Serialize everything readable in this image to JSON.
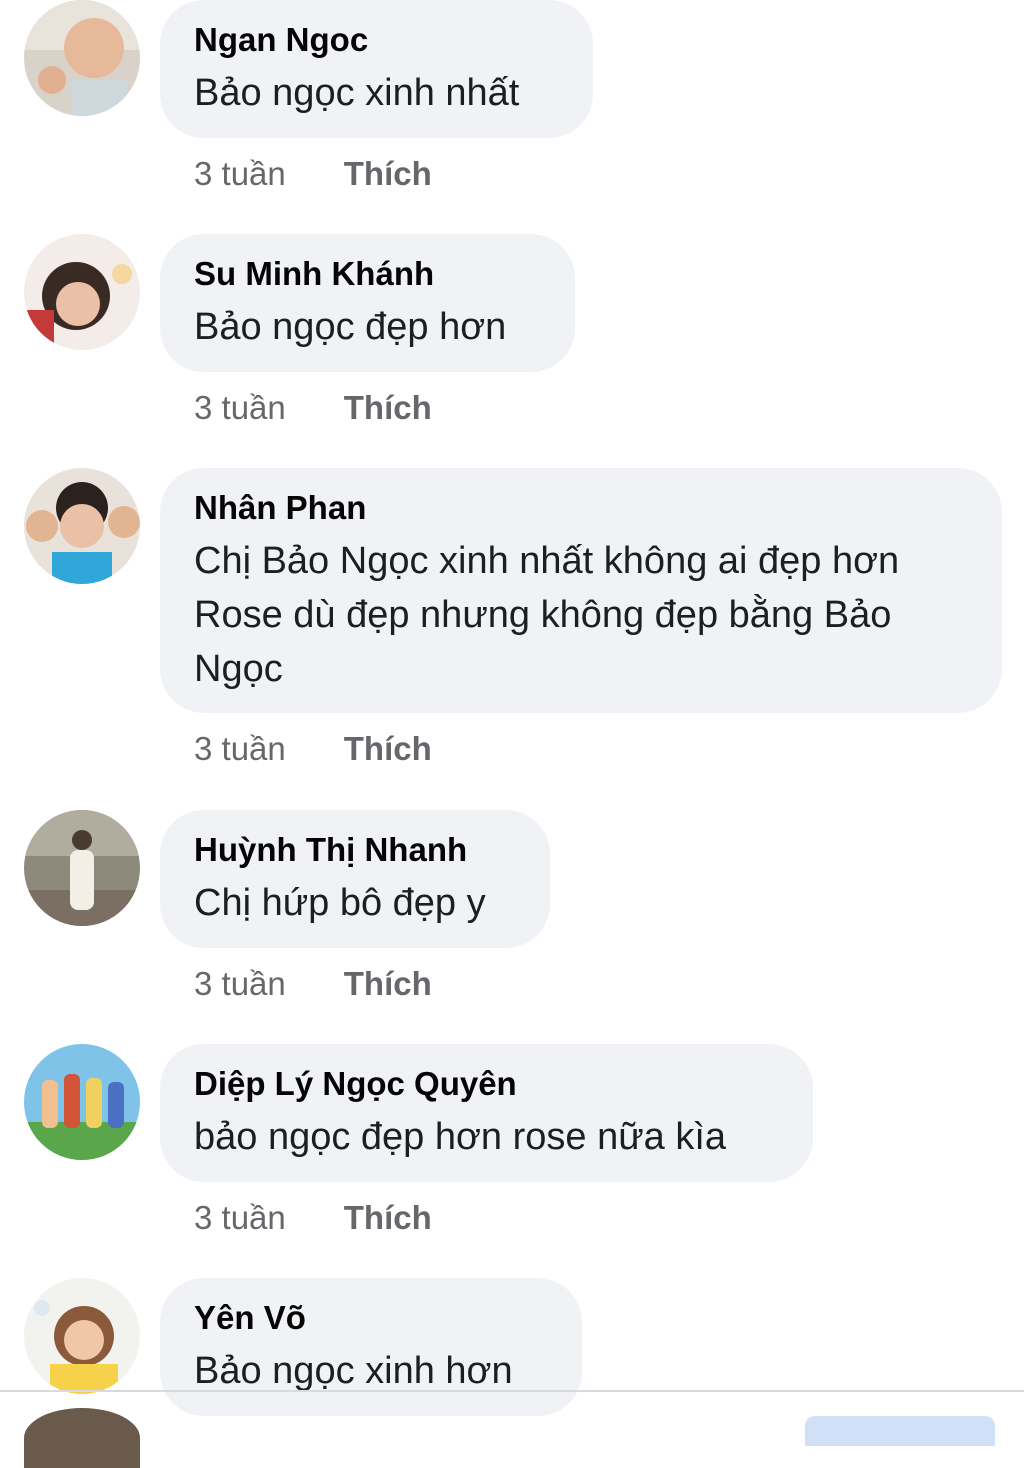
{
  "comments": [
    {
      "author": "Ngan Ngoc",
      "text": "Bảo ngọc xinh nhất",
      "time": "3 tuần",
      "like": "Thích"
    },
    {
      "author": "Su Minh Khánh",
      "text": "Bảo ngọc đẹp hơn",
      "time": "3 tuần",
      "like": "Thích"
    },
    {
      "author": "Nhân Phan",
      "text": "Chị Bảo Ngọc xinh nhất không ai đẹp hơn Rose dù đẹp nhưng không đẹp bằng Bảo Ngọc",
      "time": "3 tuần",
      "like": "Thích"
    },
    {
      "author": "Huỳnh Thị Nhanh",
      "text": "Chị hứp bô đẹp y",
      "time": "3 tuần",
      "like": "Thích"
    },
    {
      "author": "Diệp Lý Ngọc Quyên",
      "text": "bảo ngọc đẹp hơn rose nữa kìa",
      "time": "3 tuần",
      "like": "Thích"
    },
    {
      "author": "Yên Võ",
      "text": "Bảo ngọc xinh hơn"
    }
  ],
  "colors": {
    "bubble": "#f0f2f5",
    "meta_text": "#65676b",
    "author_text": "#050505"
  }
}
